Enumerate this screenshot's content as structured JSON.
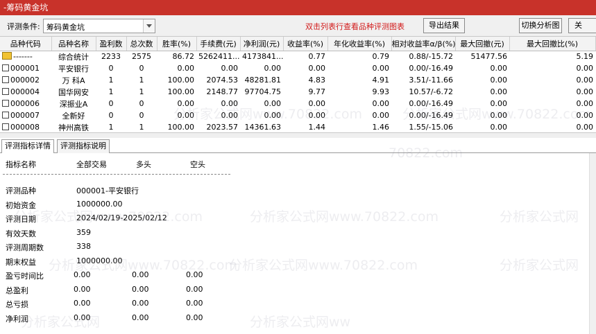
{
  "window": {
    "title": "-筹码黄金坑"
  },
  "toolbar": {
    "condition_label": "评测条件:",
    "condition_value": "筹码黄金坑",
    "hint": "双击列表行查看品种评测图表",
    "export_label": "导出结果",
    "switch_label": "切换分析图",
    "close_label": "关"
  },
  "grid": {
    "columns": [
      "品种代码",
      "品种名称",
      "盈利数",
      "总次数",
      "胜率(%)",
      "手续费(元)",
      "净利润(元)",
      "收益率(%)",
      "年化收益率(%)",
      "相对收益率α/β(%)",
      "最大回撤(元)",
      "最大回撤比(%)"
    ],
    "rows": [
      {
        "code": "-------",
        "name": "综合统计",
        "win": "2233",
        "total": "2575",
        "rate": "86.72",
        "fee": "5262411...",
        "profit": "4173841...",
        "ret": "0.77",
        "annual": "0.79",
        "rel": "0.88/-15.72",
        "mdd": "51477.56",
        "mddr": "5.19"
      },
      {
        "code": "000001",
        "name": "平安银行",
        "win": "0",
        "total": "0",
        "rate": "0.00",
        "fee": "0.00",
        "profit": "0.00",
        "ret": "0.00",
        "annual": "0.00",
        "rel": "0.00/-16.49",
        "mdd": "0.00",
        "mddr": "0.00"
      },
      {
        "code": "000002",
        "name": "万 科A",
        "win": "1",
        "total": "1",
        "rate": "100.00",
        "fee": "2074.53",
        "profit": "48281.81",
        "ret": "4.83",
        "annual": "4.91",
        "rel": "3.51/-11.66",
        "mdd": "0.00",
        "mddr": "0.00"
      },
      {
        "code": "000004",
        "name": "国华网安",
        "win": "1",
        "total": "1",
        "rate": "100.00",
        "fee": "2148.77",
        "profit": "97704.75",
        "ret": "9.77",
        "annual": "9.93",
        "rel": "10.57/-6.72",
        "mdd": "0.00",
        "mddr": "0.00"
      },
      {
        "code": "000006",
        "name": "深振业A",
        "win": "0",
        "total": "0",
        "rate": "0.00",
        "fee": "0.00",
        "profit": "0.00",
        "ret": "0.00",
        "annual": "0.00",
        "rel": "0.00/-16.49",
        "mdd": "0.00",
        "mddr": "0.00"
      },
      {
        "code": "000007",
        "name": "全新好",
        "win": "0",
        "total": "0",
        "rate": "0.00",
        "fee": "0.00",
        "profit": "0.00",
        "ret": "0.00",
        "annual": "0.00",
        "rel": "0.00/-16.49",
        "mdd": "0.00",
        "mddr": "0.00"
      },
      {
        "code": "000008",
        "name": "神州高铁",
        "win": "1",
        "total": "1",
        "rate": "100.00",
        "fee": "2023.57",
        "profit": "14361.63",
        "ret": "1.44",
        "annual": "1.46",
        "rel": "1.55/-15.06",
        "mdd": "0.00",
        "mddr": "0.00"
      }
    ]
  },
  "tabs": [
    "评测指标详情",
    "评测指标说明"
  ],
  "details": {
    "headers": [
      "指标名称",
      "全部交易",
      "多头",
      "空头"
    ],
    "rows": [
      {
        "label": "评测品种",
        "values": [
          "000001-平安银行"
        ]
      },
      {
        "label": "初始资金",
        "values": [
          "1000000.00"
        ]
      },
      {
        "label": "评测日期",
        "values": [
          "2024/02/19-2025/02/12"
        ]
      },
      {
        "label": "有效天数",
        "values": [
          "359"
        ]
      },
      {
        "label": "评测周期数",
        "values": [
          "338"
        ]
      },
      {
        "label": "期末权益",
        "values": [
          "1000000.00"
        ]
      },
      {
        "label": "盈亏时间比",
        "values": [
          "0.00",
          "0.00",
          "0.00"
        ]
      },
      {
        "label": "总盈利",
        "values": [
          "0.00",
          "0.00",
          "0.00"
        ]
      },
      {
        "label": "总亏损",
        "values": [
          "0.00",
          "0.00",
          "0.00"
        ]
      },
      {
        "label": "净利润",
        "values": [
          "0.00",
          "0.00",
          "0.00"
        ]
      }
    ]
  },
  "watermark": {
    "texts": [
      "70822.com",
      "分析家公式网www.70822.com",
      "分析家公式网www.70822.com",
      "分析家公式网www.70822.com",
      "分析家公式网",
      "分析家公式网www.70822.com",
      "分析家公式网",
      "分析家公式网www.70822.com",
      "分析家公式网",
      "分析家公式网ww",
      "分析家公式网www.70822.com"
    ]
  }
}
